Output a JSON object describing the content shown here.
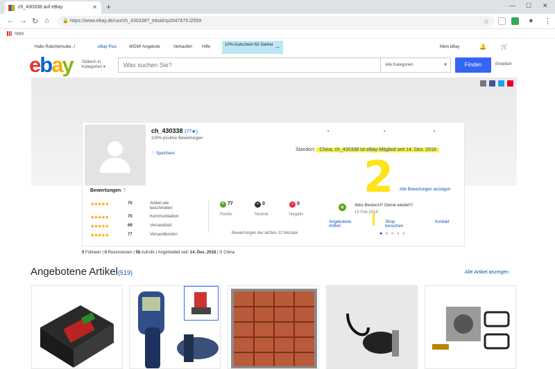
{
  "browser": {
    "tab_title": "ch_430338 auf eBay",
    "new_tab": "+",
    "url": "https://www.ebay.de/usr/ch_430338?_trksid=p2047675.l2559",
    "bookmarks_label": "Apps"
  },
  "ebay_topnav": {
    "greeting": "Hallo Rubcherlsuite...!",
    "plus": "eBay Plus",
    "wow": "WOW! Angebote",
    "sell": "Verkaufen",
    "help": "Hilfe",
    "promo": "10%-Gutschein für Gamer",
    "my_ebay": "Mein eBay"
  },
  "search": {
    "category_button": "Stöbern in Kategorien",
    "placeholder": "Was suchen Sie?",
    "category_select": "Alle Kategorien",
    "find_button": "Finden",
    "advanced": "Erweitert"
  },
  "seller": {
    "username": "ch_430338",
    "score": "(77★)",
    "positive": "100% positive Bewertungen",
    "save": "Speichern",
    "links": {
      "offered": "Angebotene Artikel",
      "shop": "Shop besuchen",
      "contact": "Kontakt"
    },
    "location_label": "Standort:",
    "location_value": "China, ch_430338 ist eBay-Mitglied seit 14. Dez. 2018"
  },
  "annotation": {
    "number": "2"
  },
  "ratings": {
    "title": "Bewertungen",
    "help": "?",
    "all_link": "Alle Bewertungen anzeigen",
    "rows": [
      {
        "stars": "★★★★★",
        "count": "70",
        "label": "Artikel wie beschrieben"
      },
      {
        "stars": "★★★★★",
        "count": "70",
        "label": "Kommunikation"
      },
      {
        "stars": "★★★★★",
        "count": "69",
        "label": "Versandzeit"
      },
      {
        "stars": "★★★★★",
        "count": "77",
        "label": "Versandkosten"
      }
    ],
    "feedback": [
      {
        "count": "77",
        "label": "Positiv",
        "color": "#5ba71b",
        "sign": "+"
      },
      {
        "count": "0",
        "label": "Neutral",
        "color": "#333333",
        "sign": "•"
      },
      {
        "count": "0",
        "label": "Negativ",
        "color": "#e53238",
        "sign": "−"
      }
    ],
    "note": "Bewertungen der letzten 12 Monate",
    "comment": "Alles Bestens!!! Gerne wieder!!!",
    "comment_date": "15 Feb 2019"
  },
  "stats": {
    "followers_n": "0",
    "followers": "Follower",
    "reviews_n": "0",
    "reviews": "Rezensionen",
    "views_n": "58",
    "views": "Aufrufe",
    "member_label": "Angemeldet seit:",
    "member_date": "14. Dez. 2018",
    "country": "China"
  },
  "items_section": {
    "title": "Angebotene Artikel",
    "count": "(519)",
    "all_link": "Alle Artikel anzeigen",
    "items": [
      "motor-controller-box",
      "infrared-thermometer",
      "resistor-kit-box",
      "ignition-coil",
      "carburetor-kit"
    ]
  }
}
